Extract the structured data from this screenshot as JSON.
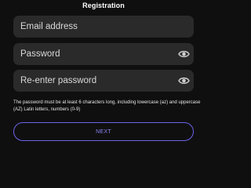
{
  "header": {
    "title": "Registration"
  },
  "form": {
    "email": {
      "value": "",
      "placeholder": "Email address"
    },
    "password": {
      "value": "",
      "placeholder": "Password",
      "icon": "eye-icon"
    },
    "confirm_password": {
      "value": "",
      "placeholder": "Re-enter password",
      "icon": "eye-icon"
    },
    "hint": "The password must be at least 6 characters long, including lowercase (az) and uppercase (AZ) Latin letters, numbers (0-9)",
    "next_label": "NEXT"
  },
  "colors": {
    "background": "#0f0f0f",
    "field": "#2a2a2a",
    "accent": "#6c63e8"
  }
}
